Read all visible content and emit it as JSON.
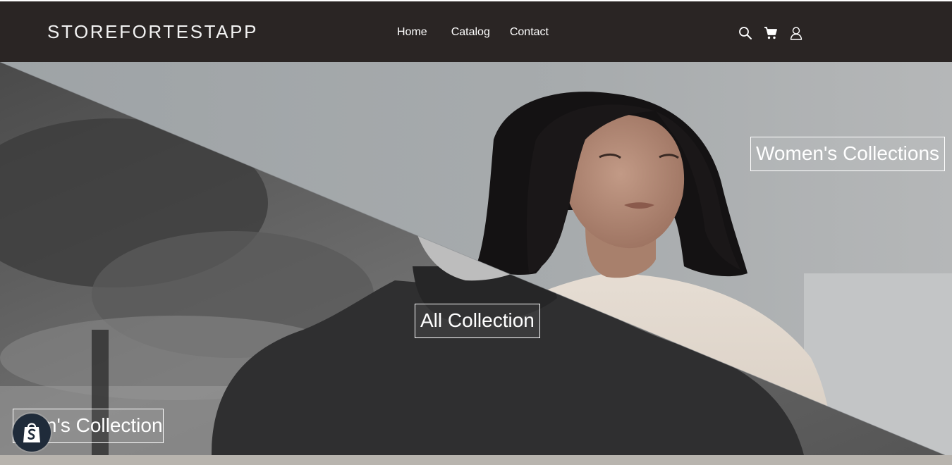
{
  "header": {
    "logo": "STOREFORTESTAPP",
    "nav": [
      {
        "label": "Home"
      },
      {
        "label": "Catalog"
      },
      {
        "label": "Contact"
      }
    ],
    "icons": [
      "search-icon",
      "cart-icon",
      "account-icon"
    ]
  },
  "hero": {
    "womens_label": "Women's Collections",
    "all_label": "All Collection",
    "mens_label": "Men's Collection"
  },
  "shopify_badge": {
    "icon": "shopify-bag-icon"
  },
  "colors": {
    "header_bg": "#2a2524",
    "hero_light": "#9a9fa3",
    "hero_dark": "#3a3a3a",
    "badge_bg": "#1f2b3a",
    "label_text": "#ffffff"
  }
}
